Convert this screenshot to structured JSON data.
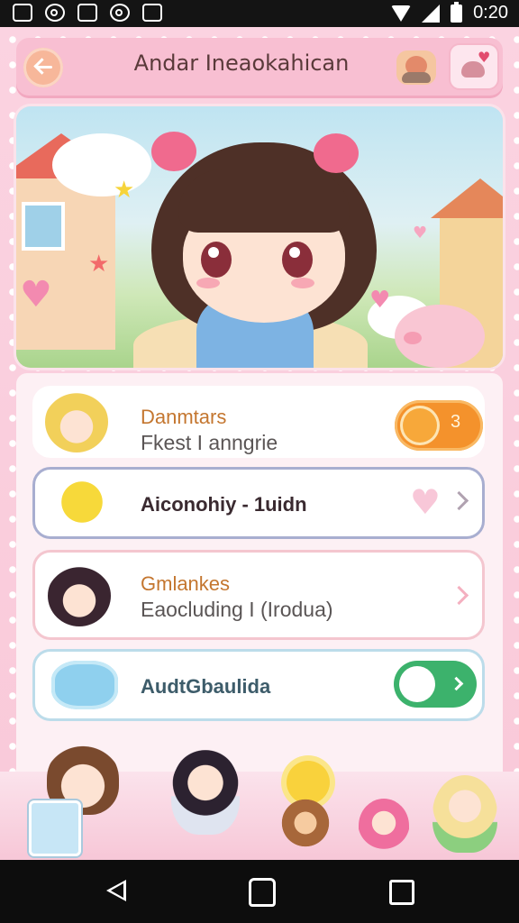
{
  "status_bar": {
    "time": "0:20"
  },
  "header": {
    "title": "Andar Ineaokahican"
  },
  "colors": {
    "accent_pink": "#f8bfd2",
    "badge_orange": "#f4922c",
    "toggle_green": "#3cb26c",
    "title_orange": "#c4762f",
    "title_dark": "#3a2a30",
    "title_teal": "#3d5c6a"
  },
  "list": {
    "items": [
      {
        "title": "Danmtars",
        "subtitle": "Fkest I anngrie",
        "trailing": "badge",
        "badge_count": "3",
        "icon": "blonde-girl-avatar"
      },
      {
        "title": "Aiconohiy - 1uidn",
        "trailing": "chevron",
        "icon": "smiley-star-icon"
      },
      {
        "title": "Gmlankes",
        "subtitle": "Eaocluding I (Irodua)",
        "trailing": "chevron",
        "icon": "dark-hair-girl-avatar"
      },
      {
        "title": "AudtGbaulida",
        "trailing": "toggle",
        "icon": "speech-bubble-icon"
      }
    ]
  },
  "bottom_strip": {
    "characters": [
      "brown-hair-kid",
      "cat-ear-girl",
      "sun-icon",
      "bear-cub",
      "pink-hair-girl",
      "blonde-girl"
    ]
  },
  "nav": {
    "buttons": [
      "back",
      "home",
      "recent"
    ]
  }
}
